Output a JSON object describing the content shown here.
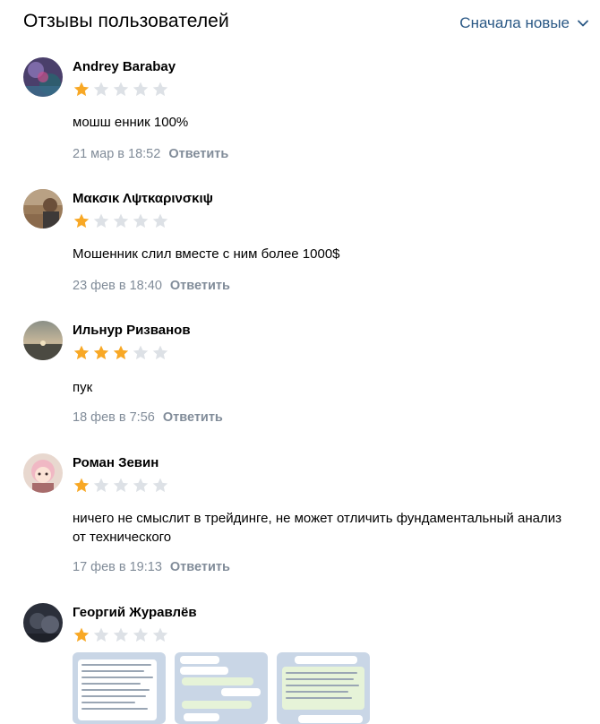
{
  "header": {
    "title": "Отзывы пользователей",
    "sort_label": "Сначала новые",
    "sort_icon": "chevron-down-icon"
  },
  "colors": {
    "accent": "#2a5885",
    "star_filled": "#f8a825",
    "star_empty": "#dde1e6",
    "meta": "#818c99"
  },
  "reviews": [
    {
      "name": "Andrey Barabay",
      "rating": 1,
      "text": "мошш енник 100%",
      "date": "21 мар в 18:52",
      "reply": "Ответить"
    },
    {
      "name": "Μακσικ Λψτκαρινσκιψ",
      "rating": 1,
      "text": "Мошенник слил вместе с ним более 1000$",
      "date": "23 фев в 18:40",
      "reply": "Ответить"
    },
    {
      "name": "Ильнур Ризванов",
      "rating": 3,
      "text": "пук",
      "date": "18 фев в 7:56",
      "reply": "Ответить"
    },
    {
      "name": "Роман Зевин",
      "rating": 1,
      "text": "ничего не смыслит в трейдинге, не может отличить фундаментальный анализ от технического",
      "date": "17 фев в 19:13",
      "reply": "Ответить"
    },
    {
      "name": "Георгий Журавлёв",
      "rating": 1,
      "text": "",
      "date": "",
      "reply": ""
    }
  ]
}
